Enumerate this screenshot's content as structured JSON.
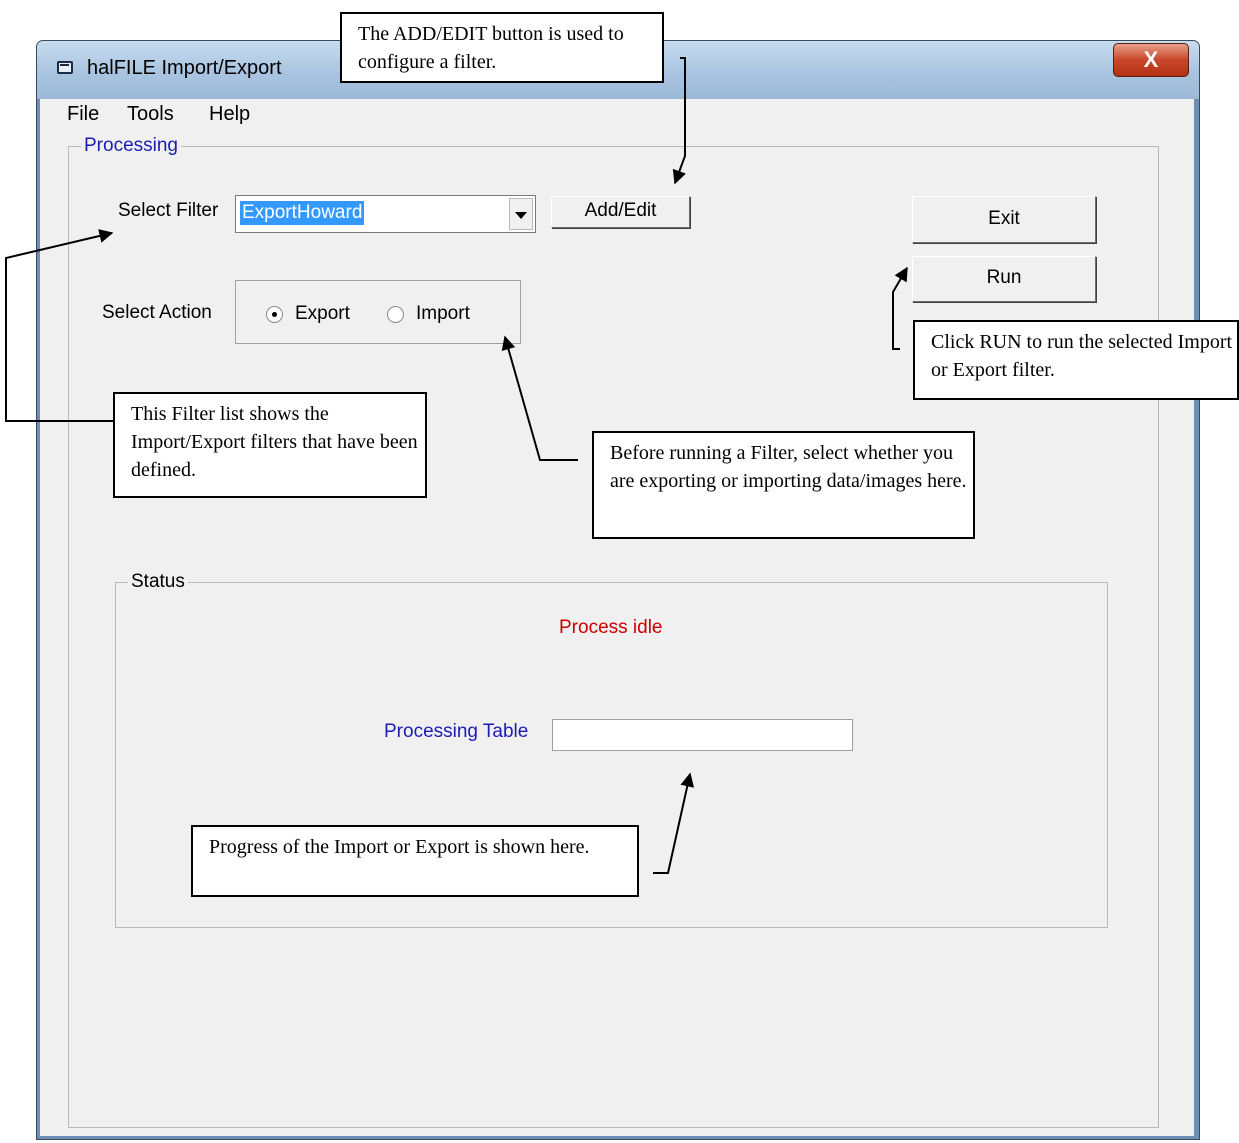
{
  "window": {
    "title": "halFILE Import/Export",
    "close_label": "X"
  },
  "menu": [
    "File",
    "Tools",
    "Help"
  ],
  "processing": {
    "group_label": "Processing",
    "select_filter_label": "Select Filter",
    "filter_value": "ExportHoward",
    "add_edit_label": "Add/Edit",
    "select_action_label": "Select Action",
    "export_label": "Export",
    "import_label": "Import",
    "selected_action": "Export",
    "exit_label": "Exit",
    "run_label": "Run"
  },
  "status": {
    "group_label": "Status",
    "message": "Process idle",
    "processing_table_label": "Processing Table",
    "processing_table_value": "",
    "message_color": "#cc0000",
    "label_color": "#1c1cb4"
  },
  "annotations": {
    "add_edit": "The ADD/EDIT button is used to configure a filter.",
    "run": "Click RUN  to run the selected Import or Export filter.",
    "filter_list": "This Filter list shows the Import/Export filters that have been defined.",
    "action": "Before running a Filter, select whether you are exporting or importing data/images here.",
    "progress": "Progress of the Import or Export is shown here."
  }
}
